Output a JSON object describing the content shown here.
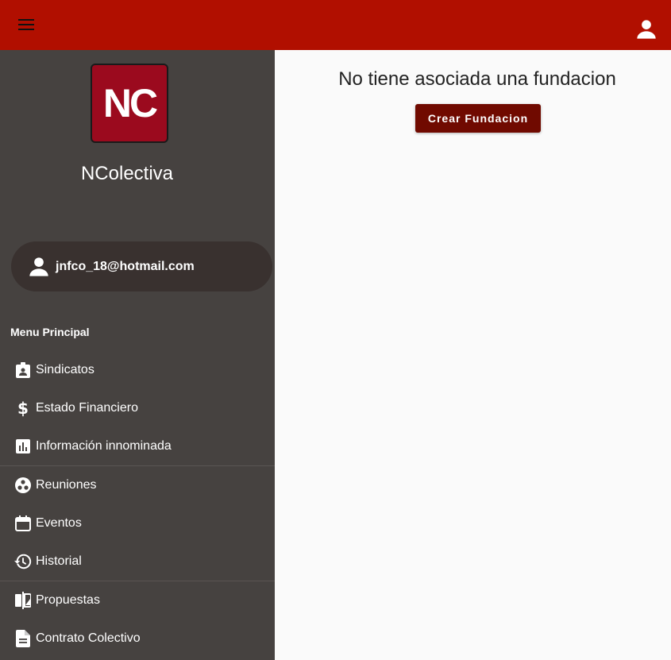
{
  "app": {
    "name": "NColectiva",
    "logo_text": "NC",
    "accent": "#b10f00"
  },
  "user": {
    "email": "jnfco_18@hotmail.com"
  },
  "menu": {
    "title": "Menu Principal",
    "groups": [
      [
        {
          "label": "Sindicatos",
          "icon": "badge-icon"
        },
        {
          "label": "Estado Financiero",
          "icon": "dollar-icon"
        },
        {
          "label": "Información innominada",
          "icon": "bar-chart-icon"
        }
      ],
      [
        {
          "label": "Reuniones",
          "icon": "workspaces-icon"
        },
        {
          "label": "Eventos",
          "icon": "calendar-icon"
        },
        {
          "label": "Historial",
          "icon": "history-icon"
        }
      ],
      [
        {
          "label": "Propuestas",
          "icon": "compare-icon"
        },
        {
          "label": "Contrato Colectivo",
          "icon": "document-icon"
        }
      ]
    ]
  },
  "main": {
    "message": "No tiene asociada una fundacion",
    "create_label": "Crear Fundacion"
  }
}
